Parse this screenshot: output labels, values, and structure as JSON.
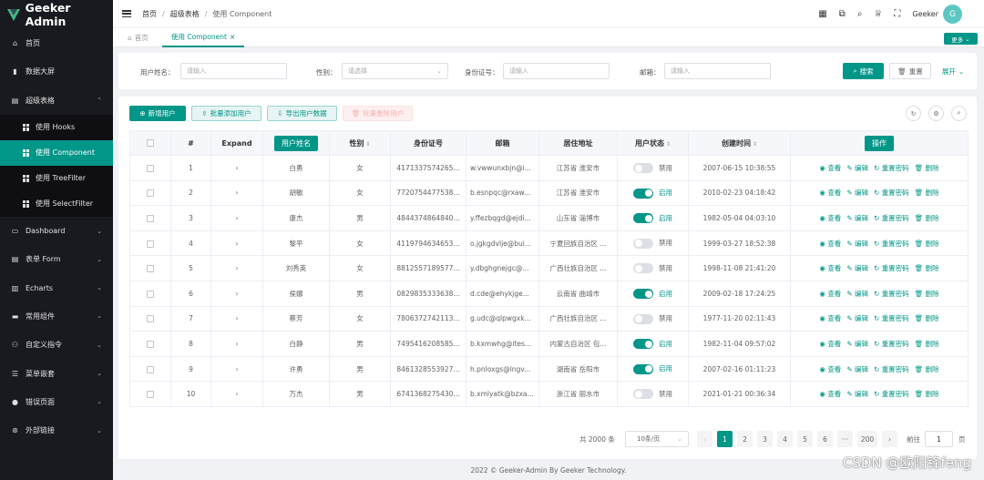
{
  "app": {
    "title": "Geeker Admin"
  },
  "sidebar": {
    "items": [
      {
        "label": "首页",
        "icon": "home-icon"
      },
      {
        "label": "数据大屏",
        "icon": "chart-icon"
      },
      {
        "label": "超级表格",
        "icon": "table-icon",
        "expanded": true,
        "children": [
          {
            "label": "使用 Hooks"
          },
          {
            "label": "使用 Component",
            "active": true
          },
          {
            "label": "使用 TreeFilter"
          },
          {
            "label": "使用 SelectFilter"
          }
        ]
      },
      {
        "label": "Dashboard",
        "icon": "dashboard-icon"
      },
      {
        "label": "表单 Form",
        "icon": "form-icon"
      },
      {
        "label": "Echarts",
        "icon": "echarts-icon"
      },
      {
        "label": "常用组件",
        "icon": "components-icon"
      },
      {
        "label": "自定义指令",
        "icon": "directive-icon"
      },
      {
        "label": "菜单嵌套",
        "icon": "nested-menu-icon"
      },
      {
        "label": "错误页面",
        "icon": "error-icon"
      },
      {
        "label": "外部链接",
        "icon": "link-icon"
      }
    ]
  },
  "header": {
    "breadcrumbs": [
      "首页",
      "超级表格",
      "使用 Component"
    ],
    "user": "Geeker",
    "avatar_text": "G"
  },
  "tabs": {
    "items": [
      {
        "label": "首页"
      },
      {
        "label": "使用 Component",
        "close": "×"
      }
    ],
    "more_label": "更多"
  },
  "search": {
    "fields": [
      {
        "label": "用户姓名：",
        "placeholder": "请输入"
      },
      {
        "label": "性别：",
        "placeholder": "请选择"
      },
      {
        "label": "身份证号：",
        "placeholder": "请输入"
      },
      {
        "label": "邮箱：",
        "placeholder": "请输入"
      }
    ],
    "search_label": "搜索",
    "reset_label": "重置",
    "expand_label": "展开"
  },
  "toolbar": {
    "add_label": "新增用户",
    "import_label": "批量添加用户",
    "export_label": "导出用户数据",
    "batch_delete_label": "批量删除用户"
  },
  "table": {
    "headers": {
      "index": "#",
      "expand": "Expand",
      "name": "用户姓名",
      "gender": "性别",
      "idcard": "身份证号",
      "email": "邮箱",
      "address": "居住地址",
      "status": "用户状态",
      "created": "创建时间",
      "ops": "操作"
    },
    "ops": {
      "view": "查看",
      "edit": "编辑",
      "reset": "重置密码",
      "delete": "删除"
    },
    "expand_glyph": "›",
    "rows": [
      {
        "idx": "1",
        "name": "白勇",
        "gender": "女",
        "idcard": "4171337574265...",
        "email": "w.vwwunxbjn@i...",
        "address": "江苏省 淮安市",
        "on": false,
        "status": "禁用",
        "created": "2007-06-15 10:38:55"
      },
      {
        "idx": "2",
        "name": "胡敏",
        "gender": "女",
        "idcard": "7720754477538...",
        "email": "b.esnpqc@rxaw...",
        "address": "江苏省 淮安市",
        "on": true,
        "status": "启用",
        "created": "2010-02-23 04:18:42"
      },
      {
        "idx": "3",
        "name": "康杰",
        "gender": "男",
        "idcard": "4844374864840...",
        "email": "y.ffezbqgd@ejdi...",
        "address": "山东省 淄博市",
        "on": true,
        "status": "启用",
        "created": "1982-05-04 04:03:10"
      },
      {
        "idx": "4",
        "name": "黎平",
        "gender": "女",
        "idcard": "4119794634653...",
        "email": "o.jgkgdvlje@bui...",
        "address": "宁夏回族自治区 ...",
        "on": false,
        "status": "禁用",
        "created": "1999-03-27 18:52:38"
      },
      {
        "idx": "5",
        "name": "刘秀英",
        "gender": "女",
        "idcard": "8812557189577...",
        "email": "y.dbghgnejgc@...",
        "address": "广西壮族自治区 ...",
        "on": false,
        "status": "禁用",
        "created": "1998-11-08 21:41:20"
      },
      {
        "idx": "6",
        "name": "侯娜",
        "gender": "男",
        "idcard": "0829835333638...",
        "email": "d.cde@ehykjge...",
        "address": "云南省 曲靖市",
        "on": true,
        "status": "启用",
        "created": "2009-02-18 17:24:25"
      },
      {
        "idx": "7",
        "name": "蔡芳",
        "gender": "女",
        "idcard": "7806372742113...",
        "email": "g.udc@qlpwgxk...",
        "address": "广西壮族自治区 ...",
        "on": false,
        "status": "禁用",
        "created": "1977-11-20 02:11:43"
      },
      {
        "idx": "8",
        "name": "白静",
        "gender": "男",
        "idcard": "7495416208585...",
        "email": "b.kxmwhg@ites...",
        "address": "内蒙古自治区 包...",
        "on": true,
        "status": "启用",
        "created": "1982-11-04 09:57:02"
      },
      {
        "idx": "9",
        "name": "许勇",
        "gender": "男",
        "idcard": "8461328553927...",
        "email": "h.pnloxgs@lngv...",
        "address": "湖南省 岳阳市",
        "on": true,
        "status": "启用",
        "created": "2007-02-16 01:11:23"
      },
      {
        "idx": "10",
        "name": "万杰",
        "gender": "男",
        "idcard": "6741368275430...",
        "email": "b.xmlyatk@bzxa...",
        "address": "浙江省 丽水市",
        "on": false,
        "status": "禁用",
        "created": "2021-01-21 00:36:34"
      }
    ]
  },
  "pagination": {
    "total": "共 2000 条",
    "page_size": "10条/页",
    "pages": [
      "1",
      "2",
      "3",
      "4",
      "5",
      "6",
      "···",
      "200"
    ],
    "prev": "‹",
    "next": "›",
    "goto_label": "前往",
    "goto_value": "1",
    "goto_suffix": "页"
  },
  "footer": "2022 © Geeker-Admin By Geeker Technology.",
  "watermark": "CSDN @欧阳锋feng",
  "colors": {
    "accent": "#009688",
    "sidebar_bg": "#191a20"
  }
}
